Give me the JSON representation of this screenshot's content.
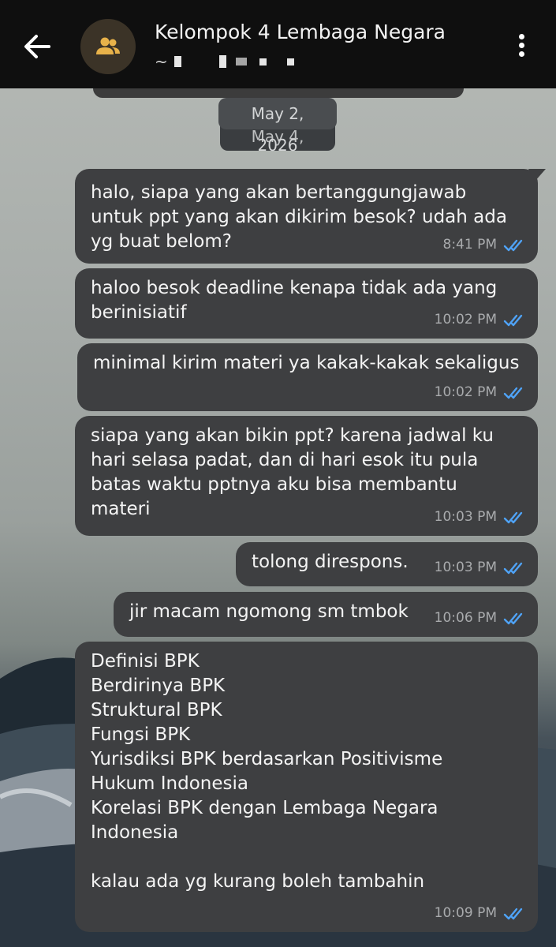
{
  "header": {
    "title": "Kelompok 4 Lembaga Negara",
    "subtitle_prefix": "~",
    "back_icon": "arrow-left-icon",
    "avatar_icon": "group-icon",
    "menu_icon": "more-vertical-icon"
  },
  "dates": {
    "behind": "May 4, 2026",
    "front": "May 2, 2026"
  },
  "messages": [
    {
      "text": "halo, siapa yang akan bertanggungjawab\nuntuk ppt yang akan dikirim besok? udah ada\nyg buat belom?",
      "time": "8:41 PM",
      "status": "read"
    },
    {
      "text": "haloo besok deadline kenapa tidak ada yang\nberinisiatif",
      "time": "10:02 PM",
      "status": "read"
    },
    {
      "text": "minimal kirim materi ya kakak-kakak sekaligus",
      "time": "10:02 PM",
      "status": "read"
    },
    {
      "text": "siapa yang akan bikin ppt? karena jadwal ku\nhari selasa padat, dan di hari esok itu pula\nbatas waktu pptnya aku bisa membantu\nmateri",
      "time": "10:03 PM",
      "status": "read"
    },
    {
      "text": "tolong direspons.",
      "time": "10:03 PM",
      "status": "read"
    },
    {
      "text": "jir macam ngomong sm tmbok",
      "time": "10:06 PM",
      "status": "read"
    },
    {
      "text": "Definisi BPK\nBerdirinya BPK\nStruktural BPK\nFungsi BPK\nYurisdiksi BPK berdasarkan Positivisme\nHukum Indonesia\nKorelasi BPK dengan Lembaga Negara\nIndonesia\n\nkalau ada yg kurang boleh tambahin",
      "time": "10:09 PM",
      "status": "read"
    }
  ],
  "colors": {
    "header_bg": "#0f0f0f",
    "bubble_bg": "#3e3f41",
    "read_ticks": "#4fa3f7",
    "avatar_bg": "#3b3327",
    "avatar_icon": "#e8b24a"
  }
}
